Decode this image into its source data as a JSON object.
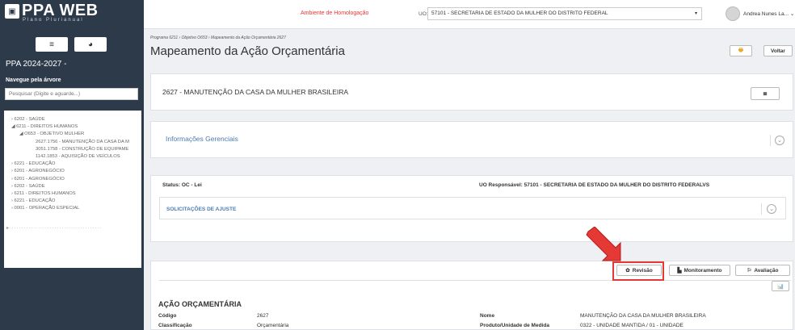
{
  "sidebar": {
    "logo_text": "PPA WEB",
    "logo_sub": "Plano Plurianual",
    "menu_icon": "≡",
    "chart_icon": "◕",
    "ppa_title": "PPA 2024-2027 -",
    "nav_label": "Navegue pela árvore",
    "search_placeholder": "Pesquisar (Digite e aguarde...)",
    "tree": [
      {
        "label": "› 6202 - SAÚDE",
        "level": 1
      },
      {
        "label": "◢ 6211 - DIREITOS HUMANOS",
        "level": 1
      },
      {
        "label": "◢ O653 - OBJETIVO MULHER",
        "level": 2
      },
      {
        "label": "2627.1756 - MANUTENÇÃO DA CASA DA M",
        "level": 3
      },
      {
        "label": "3051.1758 - CONSTRUÇÃO DE EQUIPAME",
        "level": 3
      },
      {
        "label": "1142.1853 - AQUISIÇÃO DE VEÍCULOS",
        "level": 3
      },
      {
        "label": "› 6221 - EDUCAÇÃO",
        "level": 1
      },
      {
        "label": "› 6201 - AGRONEGÓCIO",
        "level": 1
      },
      {
        "label": "› 6201 - AGRONEGÓCIO",
        "level": 1
      },
      {
        "label": "› 6202 - SAÚDE",
        "level": 1
      },
      {
        "label": "› 6211 - DIREITOS HUMANOS",
        "level": 1
      },
      {
        "label": "› 6221 - EDUCAÇÃO",
        "level": 1
      },
      {
        "label": "› 0001 - OPERAÇÃO ESPECIAL",
        "level": 1
      }
    ]
  },
  "topbar": {
    "environment": "Ambiente de Homologação",
    "uo_label": "UO:",
    "uo_value": "57101 - SECRETARIA DE ESTADO DA MULHER DO DISTRITO FEDERAL",
    "user_name": "Andrea Nunes La... ⌄"
  },
  "header": {
    "breadcrumb": "Programa 6211 › Objetivo O653 › Mapeamento da Ação Orçamentária 2627",
    "title": "Mapeamento da Ação Orçamentária",
    "print_icon": "🖶",
    "back_label": "Voltar"
  },
  "action_panel": {
    "title": "2627 - MANUTENÇÃO DA CASA DA MULHER BRASILEIRA",
    "db_icon": "≣"
  },
  "info_panel": {
    "title": "Informações Gerenciais",
    "toggle": "⌄"
  },
  "status_panel": {
    "status": "Status: OC - Lei",
    "uo_responsavel": "UO Responsável: 57101 - SECRETARIA DE ESTADO DA MULHER DO DISTRITO FEDERALVS",
    "solicitacoes": "SOLICITAÇÕES DE AJUSTE",
    "toggle": "⌄"
  },
  "toolbar": {
    "revisao": "Revisão",
    "monitoramento": "Monitoramento",
    "avaliacao": "Avaliação",
    "chart_icon": "📊"
  },
  "details": {
    "heading": "AÇÃO ORÇAMENTÁRIA",
    "codigo_label": "Código",
    "codigo_value": "2627",
    "classificacao_label": "Classificação",
    "classificacao_value": "Orçamentária",
    "nome_label": "Nome",
    "nome_value": "MANUTENÇÃO DA CASA DA MULHER BRASILEIRA",
    "produto_label": "Produto/Unidade de Medida",
    "produto_value": "0322 - UNIDADE MANTIDA / 01 - UNIDADE"
  },
  "colors": {
    "sidebar": "#2d3a4a",
    "highlight": "#e53935",
    "link": "#4a7ab5"
  }
}
